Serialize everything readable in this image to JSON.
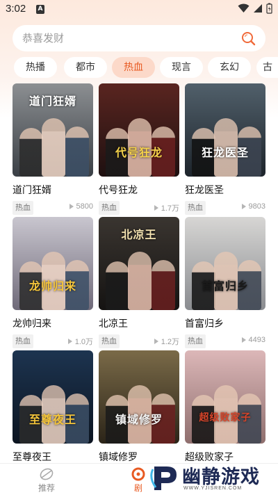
{
  "status": {
    "time": "3:02",
    "notification_badge": "A"
  },
  "search": {
    "placeholder": "恭喜发财"
  },
  "tabs": [
    {
      "label": "热播",
      "active": false
    },
    {
      "label": "都市",
      "active": false
    },
    {
      "label": "热血",
      "active": true
    },
    {
      "label": "现言",
      "active": false
    },
    {
      "label": "玄幻",
      "active": false
    },
    {
      "label": "古",
      "active": false
    }
  ],
  "cards": [
    {
      "title": "道门狂婿",
      "tag": "热血",
      "views": "5800",
      "cover_text": "道门狂婿",
      "cover_colors": [
        "#8c8f92",
        "#3a3f45"
      ]
    },
    {
      "title": "代号狂龙",
      "tag": "热血",
      "views": "1.7万",
      "cover_text": "代号狂龙",
      "cover_colors": [
        "#5a2520",
        "#1e1010"
      ]
    },
    {
      "title": "狂龙医圣",
      "tag": "热血",
      "views": "9803",
      "cover_text": "狂龙医圣",
      "cover_colors": [
        "#51606b",
        "#1d242b"
      ]
    },
    {
      "title": "龙帅归来",
      "tag": "热血",
      "views": "1.0万",
      "cover_text": "龙帅归来",
      "cover_colors": [
        "#c9c6cf",
        "#6f6a79"
      ]
    },
    {
      "title": "北凉王",
      "tag": "热血",
      "views": "1.2万",
      "cover_text": "北凉王",
      "cover_colors": [
        "#3a3530",
        "#151312"
      ]
    },
    {
      "title": "首富归乡",
      "tag": "热血",
      "views": "4493",
      "cover_text": "首富归乡",
      "cover_colors": [
        "#d7d6d4",
        "#8a8c90"
      ]
    },
    {
      "title": "至尊夜王",
      "tag": "",
      "views": "",
      "cover_text": "至尊夜王",
      "cover_colors": [
        "#1d3450",
        "#0b1420"
      ]
    },
    {
      "title": "镇域修罗",
      "tag": "",
      "views": "",
      "cover_text": "镇域修罗",
      "cover_colors": [
        "#7a6a48",
        "#2b2418"
      ]
    },
    {
      "title": "超级败家子",
      "tag": "",
      "views": "",
      "cover_text": "超级败家子",
      "cover_colors": [
        "#dcb7b8",
        "#8f6f6e"
      ]
    }
  ],
  "nav": {
    "recommend": "推荐",
    "drama": "剧"
  },
  "watermark": {
    "name": "幽静游戏",
    "url": "WWW.YJISREN.COM"
  },
  "colors": {
    "accent": "#e85a22",
    "tab_active_bg": "#fcd9c9"
  }
}
